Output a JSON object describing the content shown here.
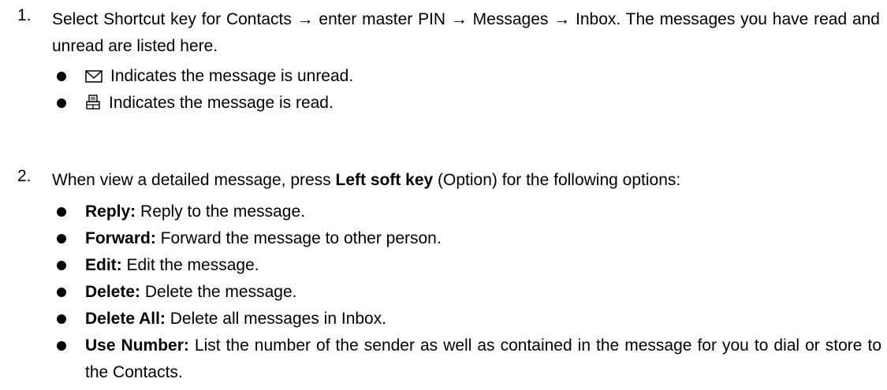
{
  "steps": [
    {
      "number": "1.",
      "text": "Select Shortcut key for Contacts → enter master PIN → Messages → Inbox. The messages you have read and unread are listed here.",
      "bullets": [
        {
          "icon": "envelope-icon",
          "text": "Indicates the message is unread."
        },
        {
          "icon": "open-mail-icon",
          "text": "Indicates the message is read."
        }
      ]
    },
    {
      "number": "2.",
      "text_before": "When view a detailed message, press ",
      "text_bold": "Left soft key",
      "text_after": " (Option) for the following options:",
      "bullets": [
        {
          "term": "Reply:",
          "desc": " Reply to the message."
        },
        {
          "term": "Forward:",
          "desc": " Forward the message to other person."
        },
        {
          "term": "Edit:",
          "desc": " Edit the message."
        },
        {
          "term": "Delete:",
          "desc": " Delete the message."
        },
        {
          "term": "Delete All:",
          "desc": " Delete all messages in Inbox."
        },
        {
          "term": "Use Number:",
          "desc": " List the number of the sender as well as contained in the message for you to dial or store to the Contacts."
        }
      ]
    }
  ]
}
